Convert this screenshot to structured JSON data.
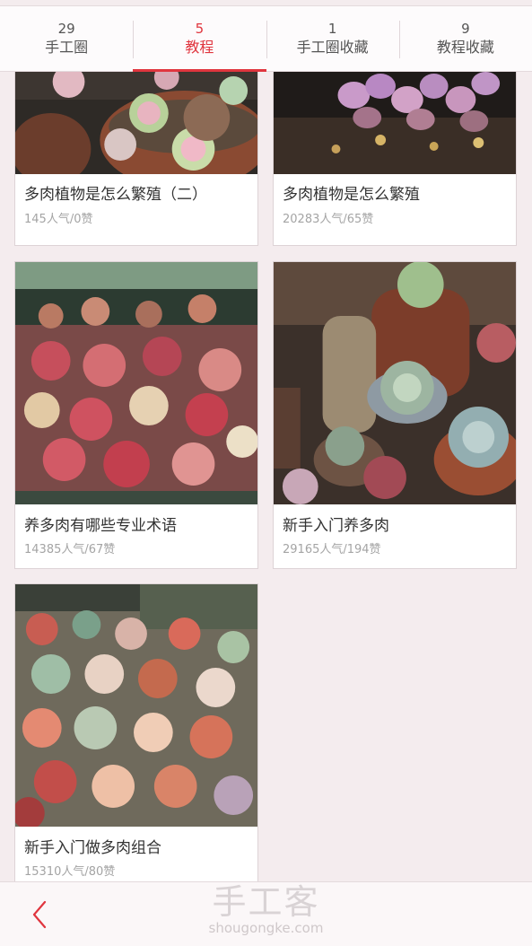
{
  "tabs": [
    {
      "count": "29",
      "label": "手工圈",
      "active": false
    },
    {
      "count": "5",
      "label": "教程",
      "active": true
    },
    {
      "count": "1",
      "label": "手工圈收藏",
      "active": false
    },
    {
      "count": "9",
      "label": "教程收藏",
      "active": false
    }
  ],
  "cards": [
    {
      "title": "多肉植物是怎么繁殖（二）",
      "stats": "145人气/0赞"
    },
    {
      "title": "多肉植物是怎么繁殖",
      "stats": "20283人气/65赞"
    },
    {
      "title": "养多肉有哪些专业术语",
      "stats": "14385人气/67赞"
    },
    {
      "title": "新手入门养多肉",
      "stats": "29165人气/194赞"
    },
    {
      "title": "新手入门做多肉组合",
      "stats": "15310人气/80赞"
    }
  ],
  "watermark": {
    "brand": "手工客",
    "url": "shougongke.com"
  },
  "colors": {
    "accent": "#e0353e",
    "background": "#f4ecee"
  },
  "icons": {
    "back": "chevron-left-icon"
  }
}
